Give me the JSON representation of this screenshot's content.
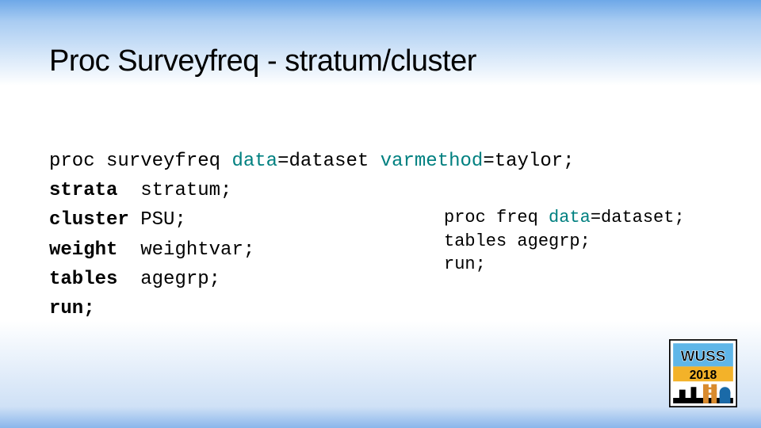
{
  "title": "Proc Surveyfreq - stratum/cluster",
  "main": {
    "line1": {
      "kw": "proc surveyfreq",
      "opt1": "data",
      "val1": "=dataset ",
      "opt2": "varmethod",
      "val2": "=taylor;"
    },
    "strata": {
      "kw": "strata",
      "arg": "stratum;"
    },
    "cluster": {
      "kw": "cluster",
      "arg": "PSU;"
    },
    "weight": {
      "kw": "weight",
      "arg": "weightvar;"
    },
    "tables": {
      "kw": "tables",
      "arg": "agegrp;"
    },
    "run": {
      "kw": "run;"
    }
  },
  "side": {
    "line1": {
      "kw": "proc freq",
      "opt": "data",
      "val": "=dataset;"
    },
    "line2": "tables agegrp;",
    "line3": "run;"
  },
  "logo": {
    "top": "WUSS",
    "year": "2018"
  }
}
